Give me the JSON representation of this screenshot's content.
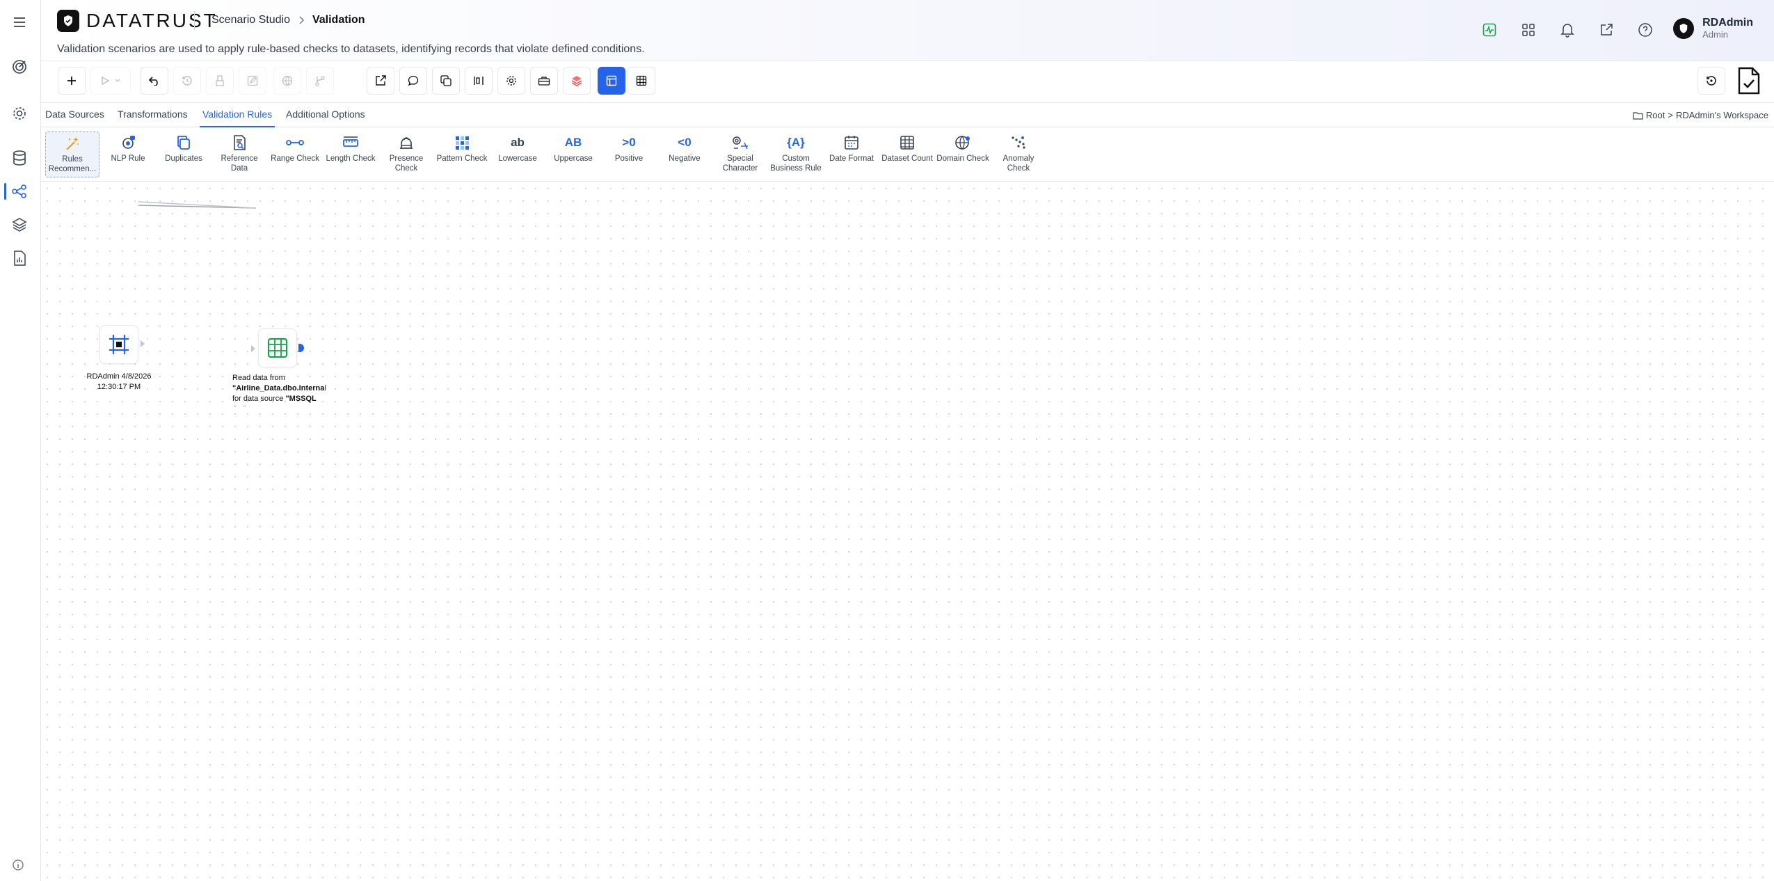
{
  "brand": {
    "name": "DATATRUST"
  },
  "breadcrumb": {
    "parent": "Scenario Studio",
    "current": "Validation"
  },
  "description": "Validation scenarios are used to apply rule-based checks to datasets, identifying records that violate defined conditions.",
  "user": {
    "name": "RDAdmin",
    "role": "Admin"
  },
  "tabs": [
    "Data Sources",
    "Transformations",
    "Validation Rules",
    "Additional Options"
  ],
  "workspace": {
    "root": "Root",
    "separator": ">",
    "name": "RDAdmin's Workspace"
  },
  "palette": [
    {
      "label": "Rules Recommen...",
      "icon": "magic-wand-icon"
    },
    {
      "label": "NLP Rule",
      "icon": "nlp-icon"
    },
    {
      "label": "Duplicates",
      "icon": "duplicates-icon"
    },
    {
      "label": "Reference Data",
      "icon": "reference-data-icon"
    },
    {
      "label": "Range Check",
      "icon": "range-icon"
    },
    {
      "label": "Length Check",
      "icon": "ruler-icon"
    },
    {
      "label": "Presence Check",
      "icon": "presence-icon"
    },
    {
      "label": "Pattern Check",
      "icon": "pattern-icon"
    },
    {
      "label": "Lowercase",
      "icon": "lowercase-icon",
      "glyph": "ab"
    },
    {
      "label": "Uppercase",
      "icon": "uppercase-icon",
      "glyph": "AB"
    },
    {
      "label": "Positive",
      "icon": "positive-icon",
      "glyph": ">0"
    },
    {
      "label": "Negative",
      "icon": "negative-icon",
      "glyph": "<0"
    },
    {
      "label": "Special Character",
      "icon": "special-character-icon"
    },
    {
      "label": "Custom Business Rule",
      "icon": "custom-rule-icon",
      "glyph": "{A}"
    },
    {
      "label": "Date Format",
      "icon": "calendar-icon"
    },
    {
      "label": "Dataset Count",
      "icon": "table-icon"
    },
    {
      "label": "Domain Check",
      "icon": "globe-icon"
    },
    {
      "label": "Anomaly Check",
      "icon": "scatter-icon"
    }
  ],
  "nodes": {
    "start": {
      "label": "RDAdmin 4/8/2026 12:30:17 PM"
    },
    "read": {
      "prefix": "Read data from ",
      "table": "\"Airline_Data.dbo.Internal_Table\"",
      "middle": " for data source ",
      "source": "\"MSSQL J...\""
    }
  },
  "colors": {
    "accent": "#2563eb",
    "brand": "#111111",
    "green": "#16a34a"
  }
}
